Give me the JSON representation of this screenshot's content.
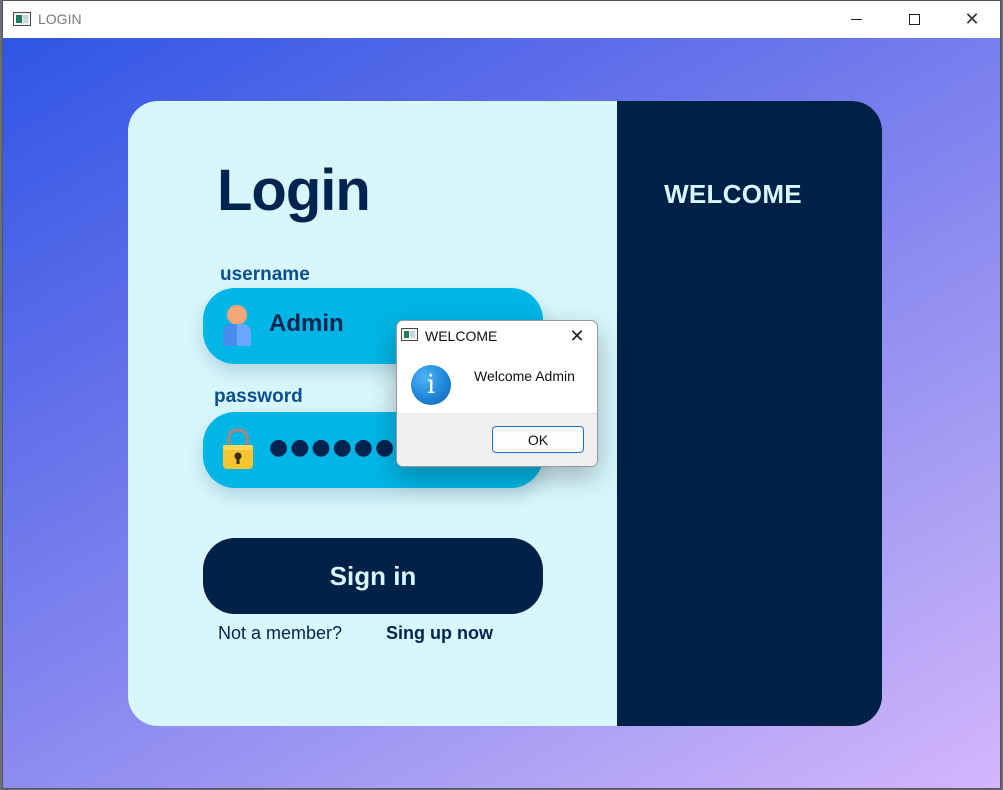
{
  "window": {
    "title": "LOGIN"
  },
  "login": {
    "title": "Login",
    "username_label": "username",
    "username_value": "Admin",
    "password_label": "password",
    "password_masked": "●●●●●●●●●",
    "signin_label": "Sign in",
    "not_member_text": "Not a member?",
    "signup_label": "Sing up now"
  },
  "side_panel": {
    "title": "WELCOME"
  },
  "dialog": {
    "title": "WELCOME",
    "message": "Welcome Admin",
    "ok_label": "OK",
    "icon": "info-icon"
  },
  "colors": {
    "navy": "#002147",
    "field": "#00b6e6",
    "card": "#d8f7fd",
    "gradient_start": "#2f56e6",
    "gradient_end": "#d5b6fc"
  }
}
